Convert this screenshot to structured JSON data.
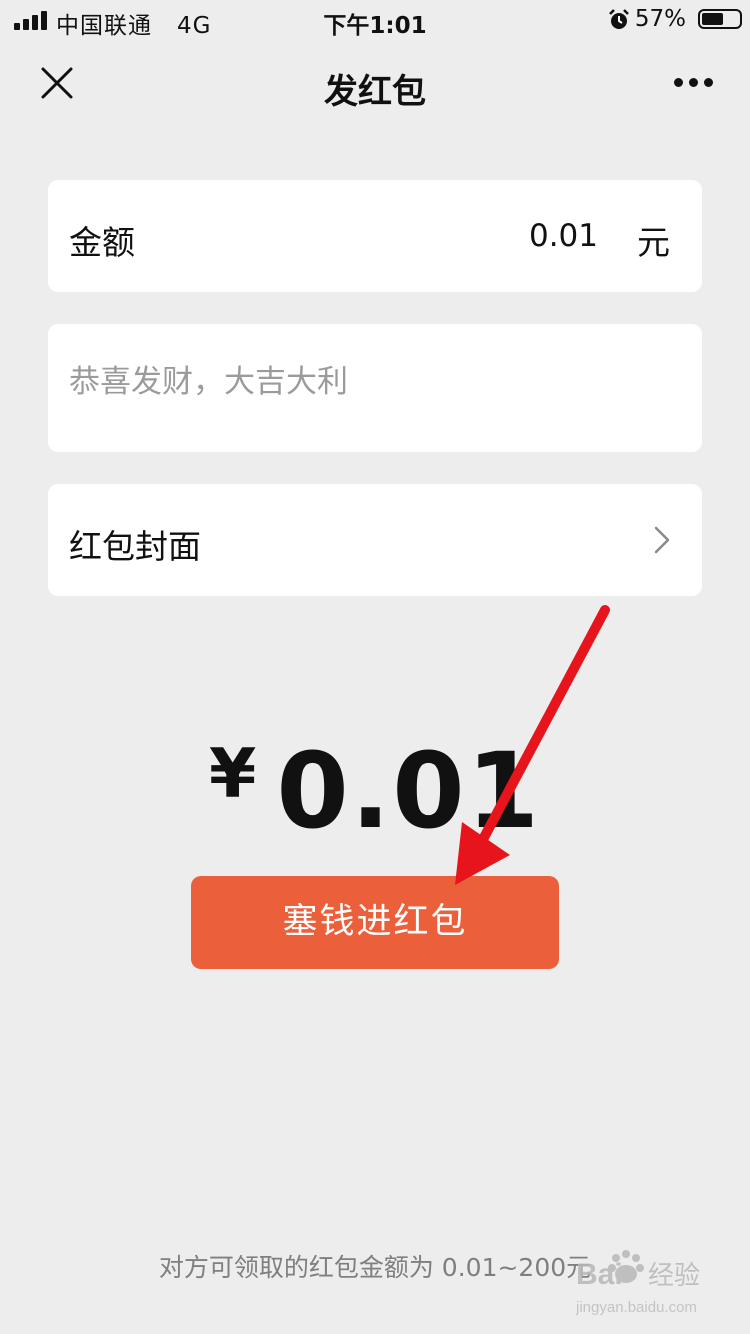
{
  "status_bar": {
    "carrier": "中国联通",
    "network": "4G",
    "time": "下午1:01",
    "battery_percent": "57%",
    "battery_level": 0.57,
    "alarm_icon": "alarm-clock-icon"
  },
  "nav": {
    "title": "发红包",
    "close_icon": "close-icon",
    "more_icon": "more-icon"
  },
  "amount_row": {
    "label": "金额",
    "value": "0.01",
    "unit": "元"
  },
  "greeting": {
    "placeholder": "恭喜发财，大吉大利",
    "value": ""
  },
  "cover_row": {
    "label": "红包封面",
    "icon": "chevron-right-icon"
  },
  "total": {
    "currency": "¥",
    "value": "0.01"
  },
  "submit_button": {
    "label": "塞钱进红包",
    "color": "#eb603b"
  },
  "footer_note": "对方可领取的红包金额为 0.01~200元",
  "annotation_arrow_color": "#e8141b",
  "watermark_text": "jingyan.baidu.com"
}
